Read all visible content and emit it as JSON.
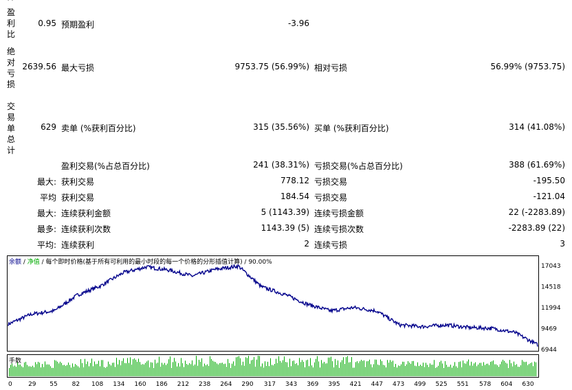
{
  "left_group_labels": {
    "top_partial": "^",
    "profit_factor": "盈\n利\n比",
    "absolute_drawdown": "绝\n对\n亏\n损",
    "total_trades": "交\n易\n单\n总\n计"
  },
  "rows": {
    "r1": {
      "v1": "0.95",
      "l2": "预期盈利",
      "v2": "-3.96"
    },
    "r2": {
      "v1": "2639.56",
      "l2": "最大亏损",
      "v2": "9753.75 (56.99%)",
      "l3": "相对亏损",
      "v3": "56.99% (9753.75)"
    },
    "r3": {
      "v1": "629",
      "l2": "卖单 (%获利百分比)",
      "v2": "315 (35.56%)",
      "l3": "买单 (%获利百分比)",
      "v3": "314 (41.08%)"
    },
    "r4": {
      "l2": "盈利交易(%占总百分比)",
      "v2": "241 (38.31%)",
      "l3": "亏损交易(%占总百分比)",
      "v3": "388 (61.69%)"
    },
    "r5": {
      "p": "最大:",
      "l2": "获利交易",
      "v2": "778.12",
      "l3": "亏损交易",
      "v3": "-195.50"
    },
    "r6": {
      "p": "平均",
      "l2": "获利交易",
      "v2": "184.54",
      "l3": "亏损交易",
      "v3": "-121.04"
    },
    "r7": {
      "p": "最大:",
      "l2": "连续获利金额",
      "v2": "5 (1143.39)",
      "l3": "连续亏损金额",
      "v3": "22 (-2283.89)"
    },
    "r8": {
      "p": "最多:",
      "l2": "连续获利次数",
      "v2": "1143.39 (5)",
      "l3": "连续亏损次数",
      "v3": "-2283.89 (22)"
    },
    "r9": {
      "p": "平均:",
      "l2": "连续获利",
      "v2": "2",
      "l3": "连续亏损",
      "v3": "3"
    }
  },
  "chart": {
    "legend_balance": "余额",
    "legend_sep": " / ",
    "legend_equity": "净值",
    "legend_rest": " / 每个即时价格(基于所有可利用的最小时段的每一个价格的分形插值计算) / 90.00%",
    "volume_label": "手数",
    "colors": {
      "balance": "#00008b",
      "volume": "#00aa00"
    }
  },
  "chart_data": {
    "type": "line",
    "series": [
      {
        "name": "余额",
        "values": [
          10000,
          11200,
          11600,
          13500,
          14600,
          16200,
          16900,
          16500,
          15800,
          16600,
          17000,
          14500,
          13600,
          12400,
          11600,
          12000,
          11600,
          9900,
          9700,
          9900,
          9600,
          9500,
          9000,
          7500
        ]
      }
    ],
    "x_ticks": [
      "0",
      "29",
      "55",
      "82",
      "108",
      "134",
      "160",
      "186",
      "212",
      "238",
      "264",
      "290",
      "317",
      "343",
      "369",
      "395",
      "421",
      "447",
      "473",
      "499",
      "525",
      "551",
      "578",
      "604",
      "630"
    ],
    "y_ticks": [
      "17043",
      "14518",
      "11994",
      "9469",
      "6944"
    ],
    "ylim": [
      6944,
      17043
    ],
    "xlim": [
      0,
      630
    ]
  }
}
